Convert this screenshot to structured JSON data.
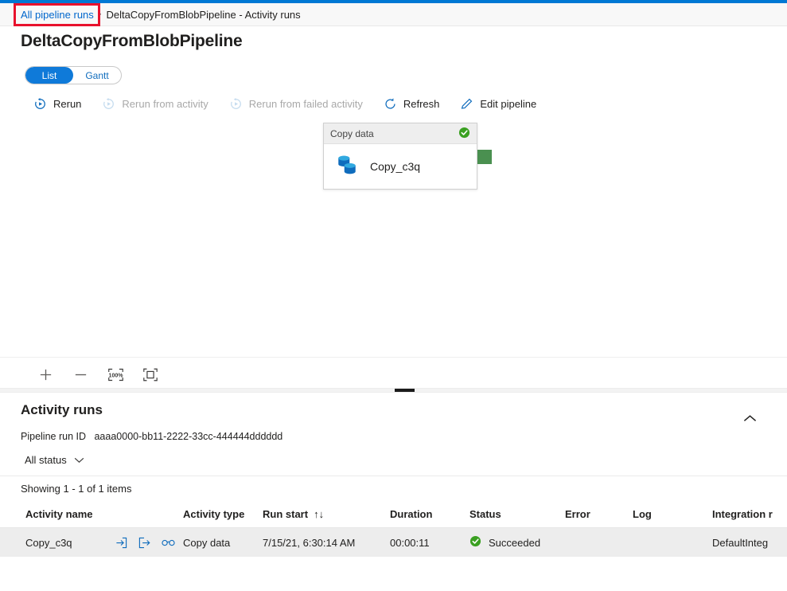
{
  "breadcrumb": {
    "link": "All pipeline runs",
    "separator": "›",
    "current": "DeltaCopyFromBlobPipeline - Activity runs"
  },
  "page": {
    "title": "DeltaCopyFromBlobPipeline",
    "accent_color": "#0078d4",
    "highlight_color": "#e8112d"
  },
  "view_toggle": {
    "list_label": "List",
    "gantt_label": "Gantt",
    "selected": "List"
  },
  "toolbar": {
    "rerun_label": "Rerun",
    "rerun_from_activity_label": "Rerun from activity",
    "rerun_from_failed_label": "Rerun from failed activity",
    "refresh_label": "Refresh",
    "edit_pipeline_label": "Edit pipeline"
  },
  "canvas": {
    "node": {
      "type_label": "Copy data",
      "name": "Copy_c3q",
      "status": "succeeded",
      "status_color": "#3aa021",
      "connector_color": "#4a9050"
    },
    "zoom_controls": [
      {
        "name": "zoom-in-icon",
        "label": "+"
      },
      {
        "name": "zoom-out-icon",
        "label": "−"
      },
      {
        "name": "zoom-100-icon",
        "label": "100%"
      },
      {
        "name": "fit-to-screen-icon",
        "label": "fit"
      }
    ]
  },
  "activity_runs": {
    "title": "Activity runs",
    "pipeline_run_id_label": "Pipeline run ID",
    "pipeline_run_id_value": "aaaa0000-bb11-2222-33cc-444444dddddd",
    "status_filter": "All status",
    "showing": "Showing 1 - 1 of 1 items",
    "columns": [
      "Activity name",
      "",
      "Activity type",
      "Run start",
      "Duration",
      "Status",
      "Error",
      "Log",
      "Integration r"
    ],
    "sort_column": "Run start",
    "rows": [
      {
        "activity_name": "Copy_c3q",
        "activity_type": "Copy data",
        "run_start": "7/15/21, 6:30:14 AM",
        "duration": "00:00:11",
        "status": "Succeeded",
        "error": "",
        "log": "",
        "integration_runtime": "DefaultInteg"
      }
    ]
  }
}
